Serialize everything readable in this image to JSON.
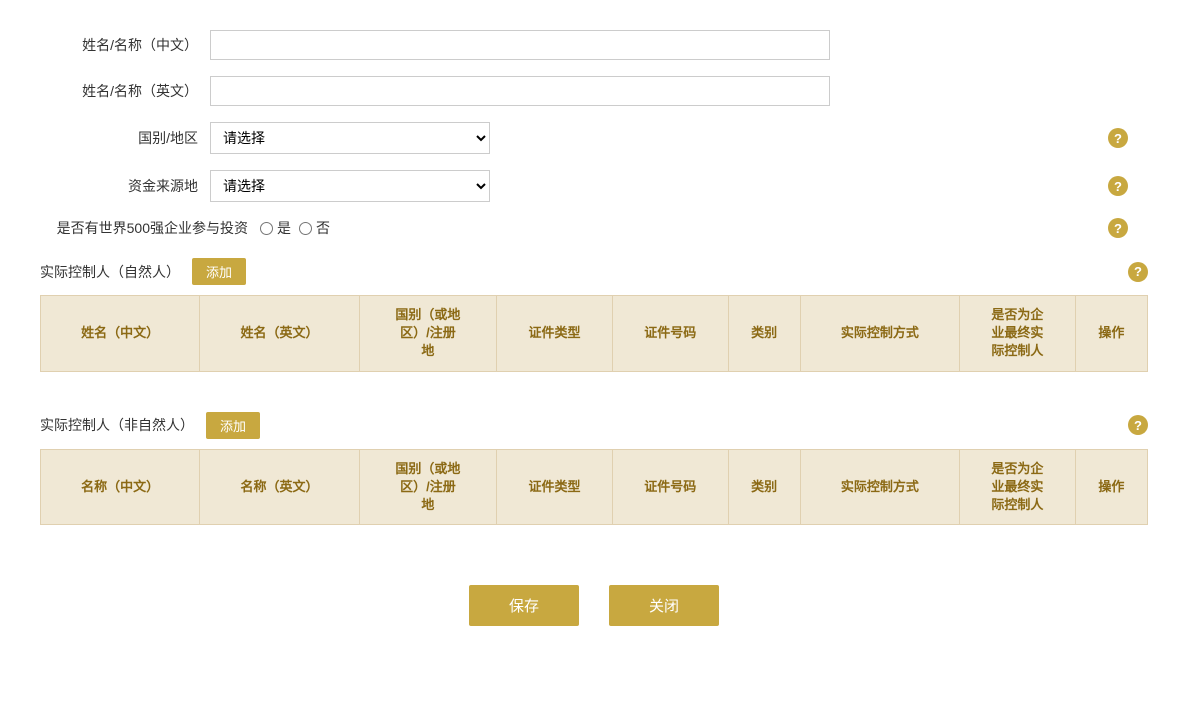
{
  "form": {
    "name_cn_label": "姓名/名称（中文）",
    "name_en_label": "姓名/名称（英文）",
    "country_label": "国别/地区",
    "country_placeholder": "请选择",
    "fund_source_label": "资金来源地",
    "fund_source_placeholder": "请选择",
    "fortune500_label": "是否有世界500强企业参与投资",
    "radio_yes": "是",
    "radio_no": "否"
  },
  "natural_person_section": {
    "title": "实际控制人（自然人）",
    "add_btn": "添加",
    "columns": [
      "姓名（中文）",
      "姓名（英文）",
      "国别（或地区）/注册地",
      "证件类型",
      "证件号码",
      "类别",
      "实际控制方式",
      "是否为企业最终实际控制人",
      "操作"
    ]
  },
  "non_natural_section": {
    "title": "实际控制人（非自然人）",
    "add_btn": "添加",
    "columns": [
      "名称（中文）",
      "名称（英文）",
      "国别（或地区）/注册地",
      "证件类型",
      "证件号码",
      "类别",
      "实际控制方式",
      "是否为企业最终实际控制人",
      "操作"
    ]
  },
  "buttons": {
    "save": "保存",
    "close": "关闭"
  },
  "help_icon": "?",
  "colors": {
    "gold": "#c8a840",
    "table_header_bg": "#f0e8d5",
    "table_header_text": "#8b6914"
  }
}
